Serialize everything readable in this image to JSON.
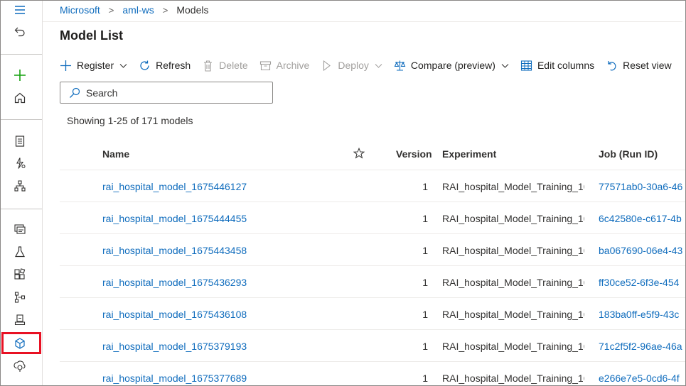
{
  "breadcrumb": {
    "items": [
      "Microsoft",
      "aml-ws"
    ],
    "current": "Models"
  },
  "page_title": "Model List",
  "toolbar": {
    "register": "Register",
    "refresh": "Refresh",
    "delete": "Delete",
    "archive": "Archive",
    "deploy": "Deploy",
    "compare": "Compare (preview)",
    "edit_columns": "Edit columns",
    "reset_view": "Reset view"
  },
  "search": {
    "placeholder": "Search"
  },
  "count_text": "Showing 1-25 of 171 models",
  "table": {
    "columns": {
      "name": "Name",
      "version": "Version",
      "experiment": "Experiment",
      "job": "Job (Run ID)"
    },
    "rows": [
      {
        "name": "rai_hospital_model_1675446127",
        "version": "1",
        "experiment": "RAI_hospital_Model_Training_16...",
        "job": "77571ab0-30a6-46"
      },
      {
        "name": "rai_hospital_model_1675444455",
        "version": "1",
        "experiment": "RAI_hospital_Model_Training_16...",
        "job": "6c42580e-c617-4b"
      },
      {
        "name": "rai_hospital_model_1675443458",
        "version": "1",
        "experiment": "RAI_hospital_Model_Training_16...",
        "job": "ba067690-06e4-43"
      },
      {
        "name": "rai_hospital_model_1675436293",
        "version": "1",
        "experiment": "RAI_hospital_Model_Training_16...",
        "job": "ff30ce52-6f3e-454"
      },
      {
        "name": "rai_hospital_model_1675436108",
        "version": "1",
        "experiment": "RAI_hospital_Model_Training_16...",
        "job": "183ba0ff-e5f9-43c"
      },
      {
        "name": "rai_hospital_model_1675379193",
        "version": "1",
        "experiment": "RAI_hospital_Model_Training_16...",
        "job": "71c2f5f2-96ae-46a"
      },
      {
        "name": "rai_hospital_model_1675377689",
        "version": "1",
        "experiment": "RAI_hospital_Model_Training_16...",
        "job": "e266e7e5-0cd6-4f"
      }
    ]
  },
  "nav_icons": [
    "hamburger-icon",
    "back-icon",
    "new-icon",
    "home-icon",
    "notebook-icon",
    "automl-icon",
    "designer-icon",
    "data-icon",
    "jobs-icon",
    "components-icon",
    "pipelines-icon",
    "environments-icon",
    "models-icon",
    "endpoints-icon"
  ],
  "colors": {
    "link": "#0f6cbd",
    "accent_green": "#13a10e",
    "selected_highlight": "#e81123"
  }
}
